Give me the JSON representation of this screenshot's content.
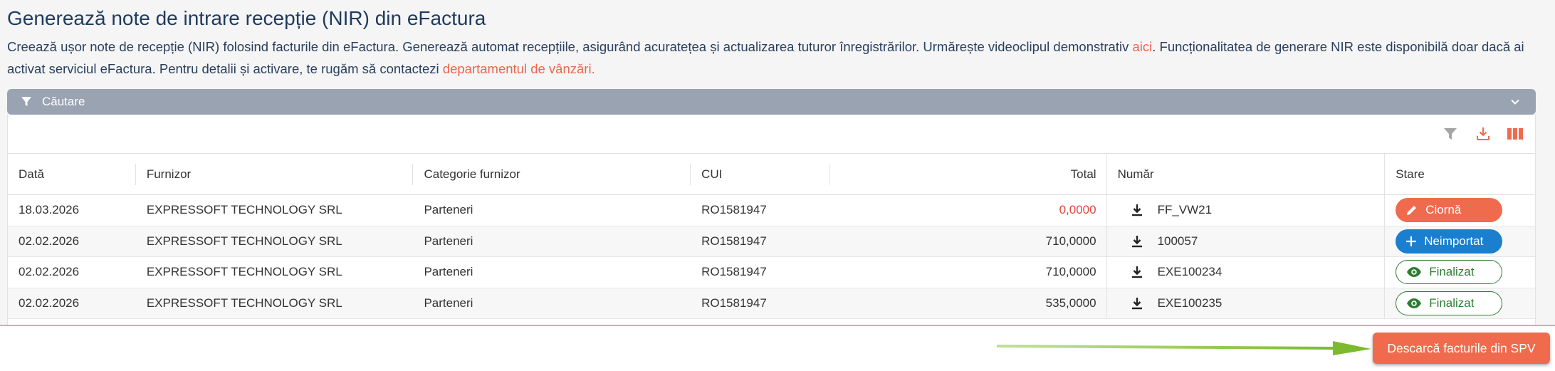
{
  "page": {
    "title": "Generează note de intrare recepție (NIR) din eFactura",
    "desc_part1": "Creează ușor note de recepție (NIR) folosind facturile din eFactura. Generează automat recepțiile, asigurând acuratețea și actualizarea tuturor înregistrărilor. Urmărește videoclipul demonstrativ ",
    "desc_link1": "aici",
    "desc_part2": ". Funcționalitatea de generare NIR este disponibilă doar dacă ai activat serviciul eFactura. Pentru detalii și activare, te rugăm să contactezi ",
    "desc_link2": "departamentul de vânzări."
  },
  "search": {
    "label": "Căutare",
    "icon": "filter-icon",
    "toggle_icon": "chevron-down-icon"
  },
  "toolbar": {
    "icons": [
      "filter-icon",
      "download-icon",
      "columns-icon"
    ]
  },
  "table": {
    "columns": [
      "Dată",
      "Furnizor",
      "Categorie furnizor",
      "CUI",
      "Total",
      "Număr",
      "Stare"
    ],
    "rows": [
      {
        "date": "18.03.2026",
        "furnizor": "EXPRESSOFT TECHNOLOGY SRL",
        "categorie": "Parteneri",
        "cui": "RO1581947",
        "total": "0,0000",
        "numar": "FF_VW21",
        "stare": "Ciornă"
      },
      {
        "date": "02.02.2026",
        "furnizor": "EXPRESSOFT TECHNOLOGY SRL",
        "categorie": "Parteneri",
        "cui": "RO1581947",
        "total": "710,0000",
        "numar": "100057",
        "stare": "Neimportat"
      },
      {
        "date": "02.02.2026",
        "furnizor": "EXPRESSOFT TECHNOLOGY SRL",
        "categorie": "Parteneri",
        "cui": "RO1581947",
        "total": "710,0000",
        "numar": "EXE100234",
        "stare": "Finalizat"
      },
      {
        "date": "02.02.2026",
        "furnizor": "EXPRESSOFT TECHNOLOGY SRL",
        "categorie": "Parteneri",
        "cui": "RO1581947",
        "total": "535,0000",
        "numar": "EXE100235",
        "stare": "Finalizat"
      }
    ]
  },
  "footer": {
    "spv_button": "Descarcă facturile din SPV"
  },
  "colors": {
    "accent": "#f06b4e",
    "title": "#1f3b5f",
    "status_draft": "#f06b4e",
    "status_not_imported": "#1a7fcf",
    "status_final": "#2e7d32",
    "arrow": "#8dc63f"
  }
}
